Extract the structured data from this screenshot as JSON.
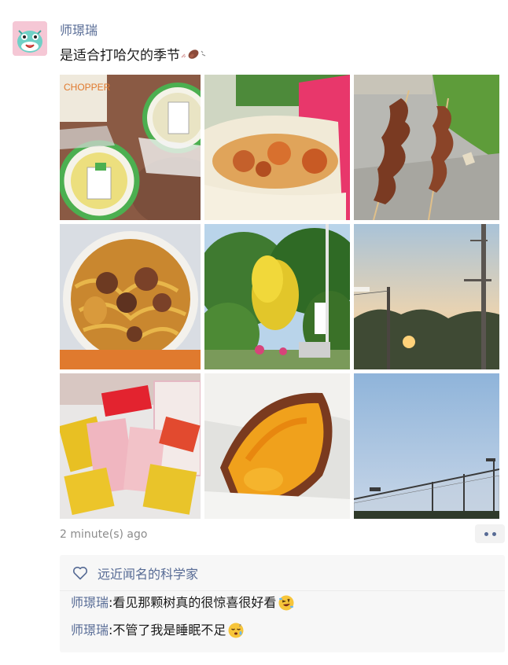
{
  "post": {
    "author": "师璟瑞",
    "text": "是适合打哈欠的季节",
    "text_emoji": "sweet-potato-emoji",
    "timestamp": "2 minute(s) ago",
    "photos": [
      {
        "name": "photo-snack-packages",
        "icon": "photo"
      },
      {
        "name": "photo-pancake-wrap",
        "icon": "photo"
      },
      {
        "name": "photo-grilled-skewers",
        "icon": "photo"
      },
      {
        "name": "photo-noodle-bowl",
        "icon": "photo"
      },
      {
        "name": "photo-park-trees",
        "icon": "photo"
      },
      {
        "name": "photo-sunset-poles",
        "icon": "photo"
      },
      {
        "name": "photo-candy-basket",
        "icon": "photo"
      },
      {
        "name": "photo-roasted-sweet-potato",
        "icon": "photo"
      },
      {
        "name": "photo-sky-net",
        "icon": "photo"
      }
    ]
  },
  "likes": {
    "icon": "heart-outline-icon",
    "names": "远近闻名的科学家"
  },
  "comments": [
    {
      "author": "师璟瑞",
      "separator": ": ",
      "text": "看见那颗树真的很惊喜很好看",
      "emoji": "rofl-emoji"
    },
    {
      "author": "师璟瑞",
      "separator": ": ",
      "text": "不管了我是睡眠不足",
      "emoji": "sleepy-face-emoji"
    }
  ],
  "colors": {
    "link": "#576b95",
    "panel_bg": "#f7f7f7",
    "timestamp": "#8c8c8c"
  }
}
